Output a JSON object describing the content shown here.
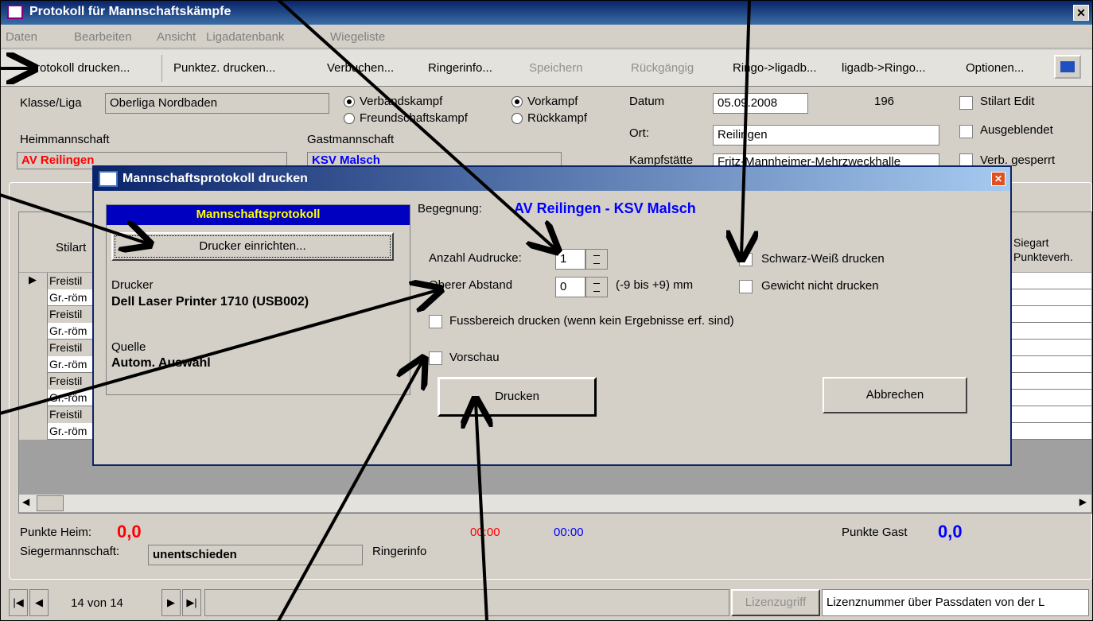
{
  "window": {
    "title": "Protokoll für Mannschaftskämpfe",
    "close": "✕"
  },
  "menu": [
    "Daten",
    "Bearbeiten",
    "Ansicht",
    "Ligadatenbank",
    "Wiegeliste"
  ],
  "toolbar": [
    "Protokoll drucken...",
    "Punktez. drucken...",
    "Verbuchen...",
    "Ringerinfo...",
    "Speichern",
    "Rückgängig",
    "Ringo->ligadb...",
    "ligadb->Ringo...",
    "Optionen..."
  ],
  "form": {
    "klasse_label": "Klasse/Liga",
    "klasse_value": "Oberliga Nordbaden",
    "verbandskampf": "Verbandskampf",
    "freundschaftskampf": "Freundschaftskampf",
    "vorkampf": "Vorkampf",
    "rueckkampf": "Rückkampf",
    "datum_label": "Datum",
    "datum_value": "05.09.2008",
    "number": "196",
    "ort_label": "Ort:",
    "ort_value": "Reilingen",
    "kampfstaette_label": "Kampfstätte",
    "kampfstaette_value": "Fritz-Mannheimer-Mehrzweckhalle",
    "heim_label": "Heimmannschaft",
    "heim_value": "AV Reilingen",
    "gast_label": "Gastmannschaft",
    "gast_value": "KSV Malsch",
    "stilart_edit": "Stilart Edit",
    "ausgeblendet": "Ausgeblendet",
    "gesperrt": "Verb. gesperrt"
  },
  "grid": {
    "col_stilart": "Stilart",
    "col_siegart": "Siegart",
    "col_punkteverh": "Punkteverh.",
    "rows": [
      "Freistil",
      "Gr.-röm",
      "Freistil",
      "Gr.-röm",
      "Freistil",
      "Gr.-röm",
      "Freistil",
      "Gr.-röm",
      "Freistil",
      "Gr.-röm"
    ]
  },
  "bottom": {
    "punkte_heim_label": "Punkte Heim:",
    "punkte_heim": "0,0",
    "time_red": "00:00",
    "time_blue": "00:00",
    "punkte_gast_label": "Punkte Gast",
    "punkte_gast": "0,0",
    "sieger_label": "Siegermannschaft:",
    "sieger_value": "unentschieden",
    "ringerinfo": "Ringerinfo"
  },
  "status": {
    "record": "14 von 14",
    "lizenz_btn": "Lizenzugriff",
    "lizenz_text": "Lizenznummer über Passdaten von der L"
  },
  "dialog": {
    "title": "Mannschaftsprotokoll drucken",
    "panel_header": "Mannschaftsprotokoll",
    "setup_btn": "Drucker einrichten...",
    "drucker_label": "Drucker",
    "drucker_value": "Dell Laser Printer 1710 (USB002)",
    "quelle_label": "Quelle",
    "quelle_value": "Autom. Auswahl",
    "begegnung_label": "Begegnung:",
    "begegnung_value": "AV Reilingen - KSV Malsch",
    "anzahl_label": "Anzahl Audrucke:",
    "anzahl_value": "1",
    "abstand_label": "Oberer Abstand",
    "abstand_value": "0",
    "abstand_hint": "(-9 bis +9) mm",
    "sw_label": "Schwarz-Weiß drucken",
    "gewicht_label": "Gewicht nicht drucken",
    "fuss_label": "Fussbereich drucken (wenn kein Ergebnisse erf. sind)",
    "vorschau_label": "Vorschau",
    "drucken_btn": "Drucken",
    "abbrechen_btn": "Abbrechen"
  },
  "colors": {
    "title_blue": "#0a246a",
    "red": "#ff0000",
    "blue": "#0000ff",
    "panel_blue": "#0000c0",
    "panel_yellow": "#ffff00"
  }
}
